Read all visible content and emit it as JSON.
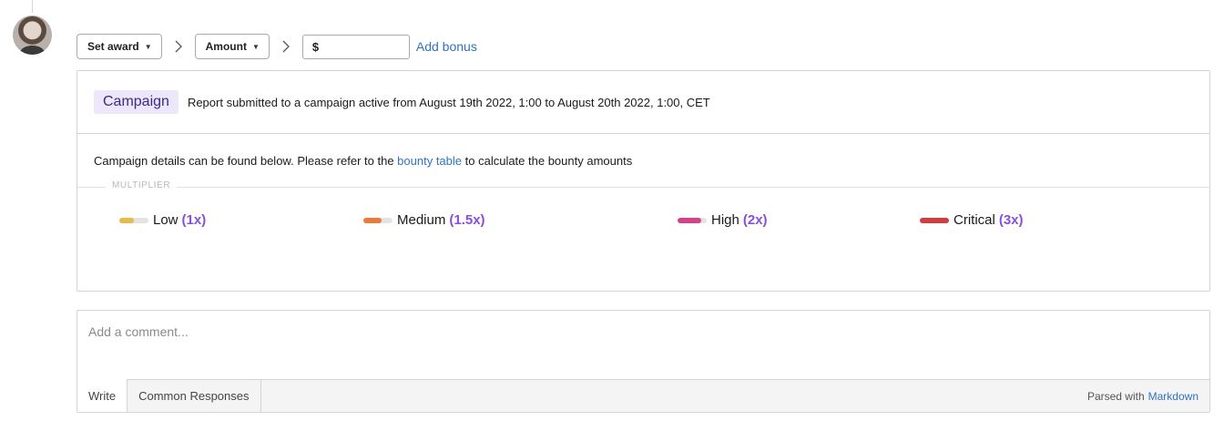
{
  "toolbar": {
    "award_dropdown": "Set award",
    "amount_dropdown": "Amount",
    "amount_value": "$",
    "add_bonus": "Add bonus"
  },
  "campaign": {
    "badge": "Campaign",
    "summary": "Report submitted to a campaign active from August 19th 2022, 1:00 to August 20th 2022, 1:00, CET",
    "details_prefix": "Campaign details can be found below. Please refer to the",
    "details_link": "bounty table",
    "details_suffix": "to calculate the bounty amounts",
    "multiplier_label": "MULTIPLIER",
    "levels": [
      {
        "name": "Low",
        "multiplier": "(1x)",
        "color": "#e9b949",
        "level": 0.5
      },
      {
        "name": "Medium",
        "multiplier": "(1.5x)",
        "color": "#ea7b3a",
        "level": 0.62
      },
      {
        "name": "High",
        "multiplier": "(2x)",
        "color": "#d93f8a",
        "level": 0.8
      },
      {
        "name": "Critical",
        "multiplier": "(3x)",
        "color": "#d23c3c",
        "level": 1.0
      }
    ]
  },
  "comment": {
    "placeholder": "Add a comment...",
    "tabs": [
      "Write",
      "Common Responses"
    ],
    "parsed_prefix": "Parsed with",
    "parsed_link": "Markdown"
  },
  "icons": [
    "chevron-right-icon",
    "caret-down-icon"
  ]
}
